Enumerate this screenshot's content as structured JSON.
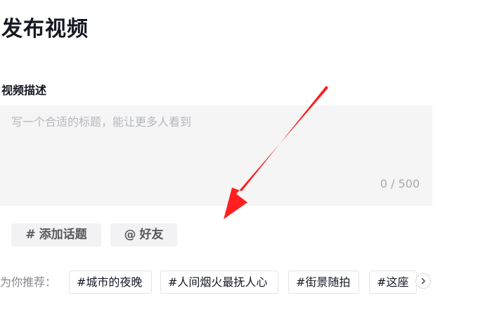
{
  "page": {
    "title": "发布视频"
  },
  "description": {
    "label": "视频描述",
    "placeholder": "写一个合适的标题，能让更多人看到",
    "value": "",
    "counter": "0 / 500"
  },
  "actions": {
    "topic": {
      "symbol": "#",
      "label": "添加话题"
    },
    "friend": {
      "symbol": "@",
      "label": "好友"
    }
  },
  "recommend": {
    "label": "为你推荐：",
    "tags": [
      "#城市的夜晚",
      "#人间烟火最抚人心",
      "#街景随拍",
      "#这座"
    ]
  },
  "colors": {
    "annotation_arrow": "#ff1f1f",
    "chip_background": "#f2f2f4",
    "input_background": "#f5f5f5"
  },
  "icons": {
    "scroll_next": "chevron-right-icon",
    "annotation": "red-arrow-icon"
  }
}
